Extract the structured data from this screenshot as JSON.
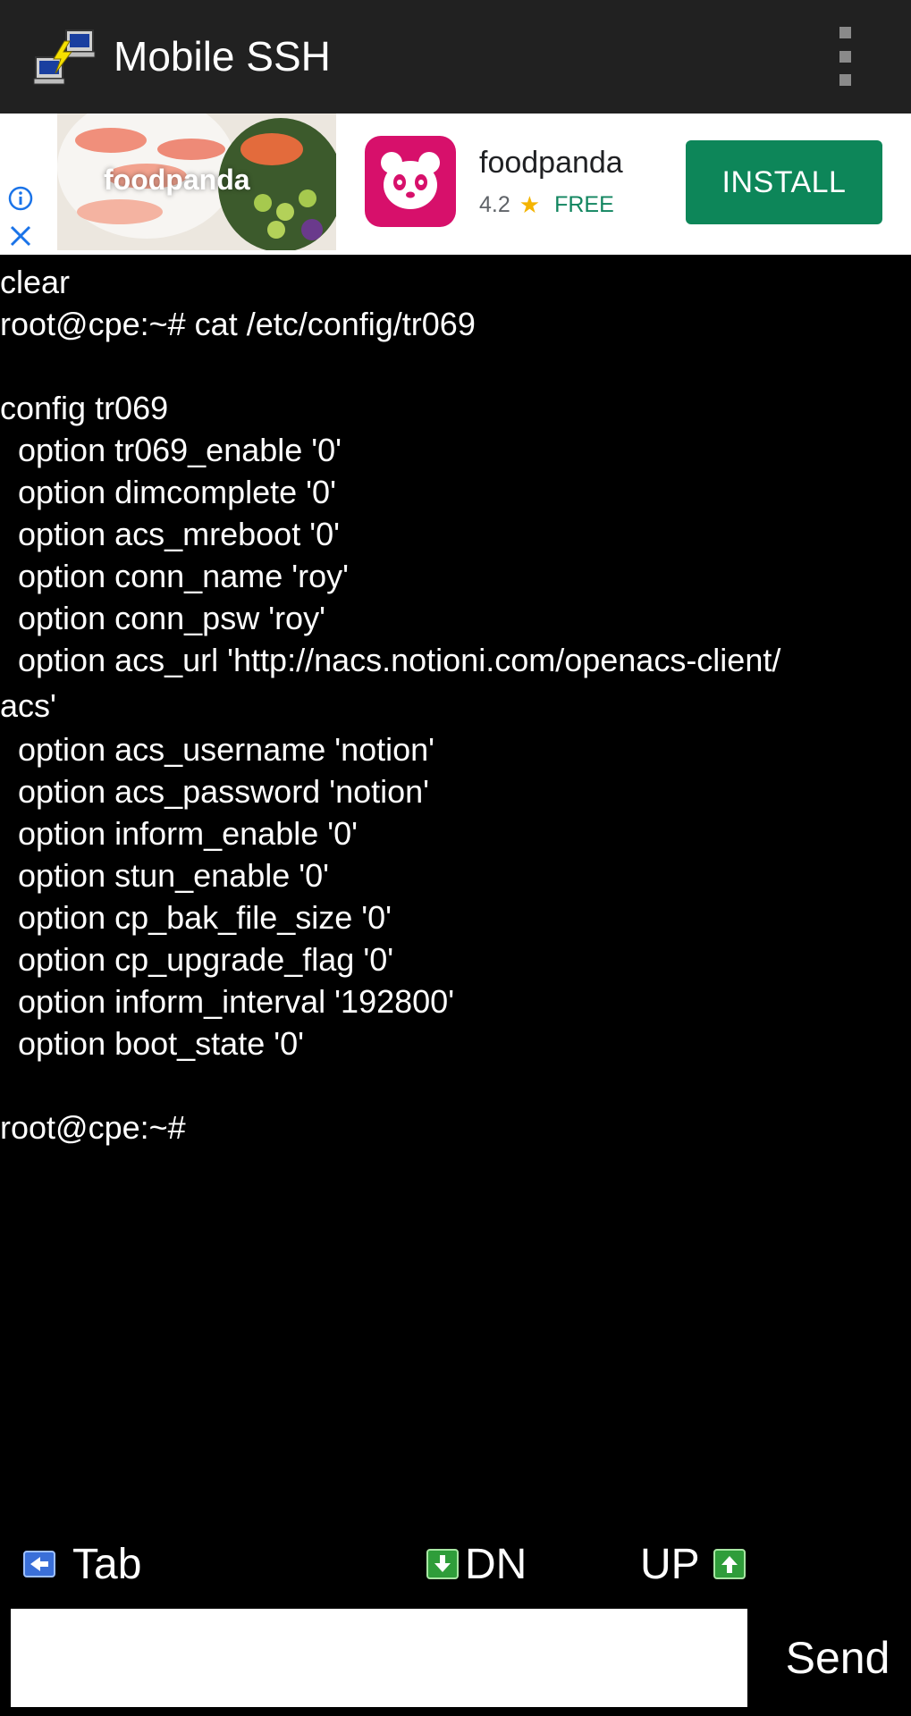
{
  "app_bar": {
    "title": "Mobile SSH",
    "icon": "network-computers-icon",
    "overflow_icon": "more-vert-icon"
  },
  "ad": {
    "image_brand_text": "foodpanda",
    "app_name": "foodpanda",
    "rating": "4.2",
    "price": "FREE",
    "install_label": "INSTALL",
    "info_icon": "info-icon",
    "close_icon": "close-icon",
    "colors": {
      "install": "#0d8659",
      "logo": "#d7106b",
      "free": "#11855f",
      "star": "#f4b400"
    }
  },
  "terminal": {
    "lines": [
      "clear",
      "root@cpe:~# cat /etc/config/tr069",
      "",
      "config tr069",
      "  option tr069_enable '0'",
      "  option dimcomplete '0'",
      "  option acs_mreboot '0'",
      "  option conn_name 'roy'",
      "  option conn_psw 'roy'",
      "  option acs_url 'http://nacs.notioni.com/openacs-client/",
      "acs'",
      "  option acs_username 'notion'",
      "  option acs_password 'notion'",
      "  option inform_enable '0'",
      "  option stun_enable '0'",
      "  option cp_bak_file_size '0'",
      "  option cp_upgrade_flag '0'",
      "  option inform_interval '192800'",
      "  option boot_state '0'",
      "",
      "root@cpe:~#"
    ]
  },
  "keys": {
    "tab_label": "Tab",
    "dn_label": "DN",
    "up_label": "UP"
  },
  "input": {
    "value": "",
    "placeholder": "",
    "send_label": "Send"
  }
}
